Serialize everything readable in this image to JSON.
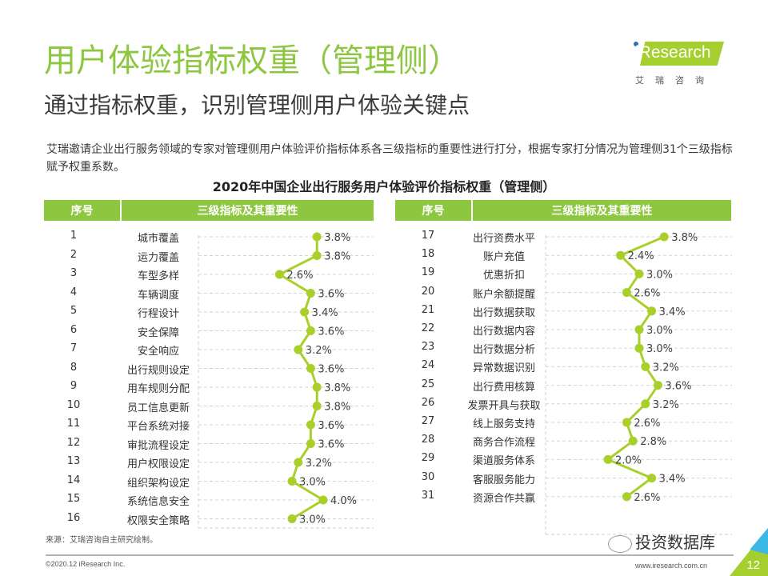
{
  "header": {
    "title": "用户体验指标权重（管理侧）",
    "subtitle": "通过指标权重，识别管理侧用户体验关键点"
  },
  "logo": {
    "brand": "iResearch",
    "cn": "艾瑞咨询",
    "color": "#a4cf2e"
  },
  "description": "艾瑞邀请企业出行服务领域的专家对管理侧用户体验评价指标体系各三级指标的重要性进行打分，根据专家打分情况为管理侧31个三级指标赋予权重系数。",
  "table_headers": {
    "index": "序号",
    "indicator": "三级指标及其重要性"
  },
  "colors": {
    "accent": "#8dc63f",
    "line": "#a8cf2a"
  },
  "chart_data": {
    "type": "line",
    "title": "2020年中国企业出行服务用户体验评价指标权重（管理侧）",
    "xlabel": "",
    "ylabel": "",
    "grid": true,
    "value_unit": "%",
    "xlim": [
      0,
      5.5
    ],
    "panels": [
      {
        "name": "left",
        "rows": [
          {
            "index": "1",
            "name": "城市覆盖",
            "value": 3.8,
            "label": "3.8%"
          },
          {
            "index": "2",
            "name": "运力覆盖",
            "value": 3.8,
            "label": "3.8%"
          },
          {
            "index": "3",
            "name": "车型多样",
            "value": 2.6,
            "label": "2.6%"
          },
          {
            "index": "4",
            "name": "车辆调度",
            "value": 3.6,
            "label": "3.6%"
          },
          {
            "index": "5",
            "name": "行程设计",
            "value": 3.4,
            "label": "3.4%"
          },
          {
            "index": "6",
            "name": "安全保障",
            "value": 3.6,
            "label": "3.6%"
          },
          {
            "index": "7",
            "name": "安全响应",
            "value": 3.2,
            "label": "3.2%"
          },
          {
            "index": "8",
            "name": "出行规则设定",
            "value": 3.6,
            "label": "3.6%"
          },
          {
            "index": "9",
            "name": "用车规则分配",
            "value": 3.8,
            "label": "3.8%"
          },
          {
            "index": "10",
            "name": "员工信息更新",
            "value": 3.8,
            "label": "3.8%"
          },
          {
            "index": "11",
            "name": "平台系统对接",
            "value": 3.6,
            "label": "3.6%"
          },
          {
            "index": "12",
            "name": "审批流程设定",
            "value": 3.6,
            "label": "3.6%"
          },
          {
            "index": "13",
            "name": "用户权限设定",
            "value": 3.2,
            "label": "3.2%"
          },
          {
            "index": "14",
            "name": "组织架构设定",
            "value": 3.0,
            "label": "3.0%"
          },
          {
            "index": "15",
            "name": "系统信息安全",
            "value": 4.0,
            "label": "4.0%"
          },
          {
            "index": "16",
            "name": "权限安全策略",
            "value": 3.0,
            "label": "3.0%"
          }
        ]
      },
      {
        "name": "right",
        "rows": [
          {
            "index": "17",
            "name": "出行资费水平",
            "value": 3.8,
            "label": "3.8%"
          },
          {
            "index": "18",
            "name": "账户充值",
            "value": 2.4,
            "label": "2.4%"
          },
          {
            "index": "19",
            "name": "优惠折扣",
            "value": 3.0,
            "label": "3.0%"
          },
          {
            "index": "20",
            "name": "账户余额提醒",
            "value": 2.6,
            "label": "2.6%"
          },
          {
            "index": "21",
            "name": "出行数据获取",
            "value": 3.4,
            "label": "3.4%"
          },
          {
            "index": "22",
            "name": "出行数据内容",
            "value": 3.0,
            "label": "3.0%"
          },
          {
            "index": "23",
            "name": "出行数据分析",
            "value": 3.0,
            "label": "3.0%"
          },
          {
            "index": "24",
            "name": "异常数据识别",
            "value": 3.2,
            "label": "3.2%"
          },
          {
            "index": "25",
            "name": "出行费用核算",
            "value": 3.6,
            "label": "3.6%"
          },
          {
            "index": "26",
            "name": "发票开具与获取",
            "value": 3.2,
            "label": "3.2%"
          },
          {
            "index": "27",
            "name": "线上服务支持",
            "value": 2.6,
            "label": "2.6%"
          },
          {
            "index": "28",
            "name": "商务合作流程",
            "value": 2.8,
            "label": "2.8%"
          },
          {
            "index": "29",
            "name": "渠道服务体系",
            "value": 2.0,
            "label": "2.0%"
          },
          {
            "index": "30",
            "name": "客服服务能力",
            "value": 3.4,
            "label": "3.4%"
          },
          {
            "index": "31",
            "name": "资源合作共赢",
            "value": 2.6,
            "label": "2.6%"
          }
        ]
      }
    ]
  },
  "footer": {
    "source": "来源：艾瑞咨询自主研究绘制。",
    "copyright": "©2020.12 iResearch Inc.",
    "url": "www.iresearch.com.cn",
    "page": "12",
    "watermark": "投资数据库"
  }
}
